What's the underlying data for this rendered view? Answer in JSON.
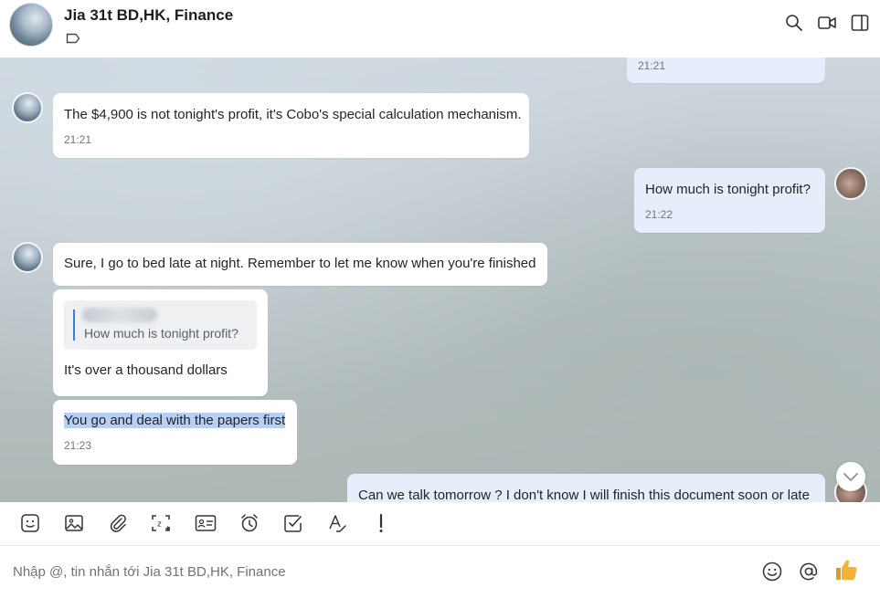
{
  "header": {
    "title": "Jia 31t BD,HK, Finance",
    "icons": [
      "tag-icon",
      "search-icon",
      "video-call-icon",
      "sidebar-toggle-icon"
    ]
  },
  "messages": [
    {
      "side": "me",
      "text": "",
      "time": "21:21"
    },
    {
      "side": "other",
      "text": "The $4,900 is not tonight's profit, it's Cobo's special calculation mechanism.",
      "time": "21:21"
    },
    {
      "side": "me",
      "text": "How much is tonight profit?",
      "time": "21:22"
    },
    {
      "side": "other",
      "text": "Sure, I go to bed late at night. Remember to let me know when you're finished",
      "time": ""
    },
    {
      "side": "other",
      "quote": "How much is tonight profit?",
      "text": "It's over a thousand dollars",
      "time": ""
    },
    {
      "side": "other",
      "text": "You go and deal with the papers first",
      "time": "21:23",
      "selected": true
    },
    {
      "side": "me",
      "text": "Can we talk tomorrow ? I don't know I will finish this document soon or late",
      "time": ""
    }
  ],
  "toolbar": {
    "icons": [
      "sticker-icon",
      "image-icon",
      "attachment-icon",
      "screenshot-icon",
      "contact-card-icon",
      "reminder-icon",
      "todo-icon",
      "text-format-icon",
      "urgent-icon"
    ]
  },
  "composer": {
    "placeholder": "Nhập @, tin nhắn tới Jia 31t BD,HK, Finance",
    "value": "",
    "icons": [
      "emoji-icon",
      "mention-icon",
      "thumbs-up-icon"
    ]
  },
  "colors": {
    "my_bubble": "#e6eefc",
    "other_bubble": "#ffffff",
    "selection": "#b6d0f5",
    "quote_bar": "#3e7ae6",
    "thumbs_up": "#f2b233"
  }
}
